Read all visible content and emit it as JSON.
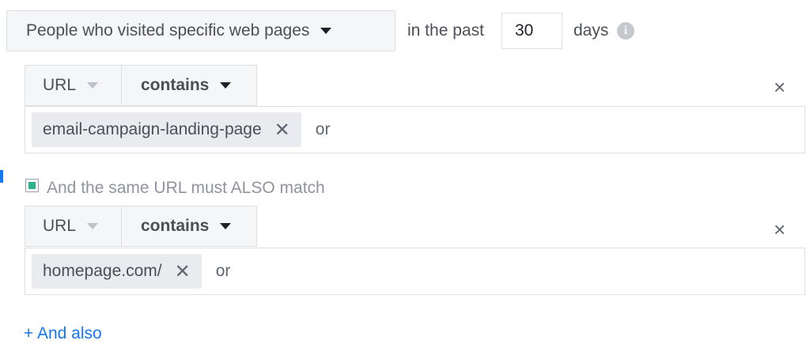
{
  "audience": {
    "selector_label": "People who visited specific web pages",
    "in_the_past_label": "in the past",
    "days_value": "30",
    "days_label": "days"
  },
  "rules": [
    {
      "field_label": "URL",
      "operator_label": "contains",
      "tokens": [
        "email-campaign-landing-page"
      ],
      "or_label": "or"
    },
    {
      "field_label": "URL",
      "operator_label": "contains",
      "tokens": [
        "homepage.com/"
      ],
      "or_label": "or"
    }
  ],
  "same_url_match": {
    "label": "And the same URL must ALSO match",
    "checked": true
  },
  "and_also_link": "+ And also",
  "icons": {
    "remove": "×",
    "token_remove": "✕",
    "info": "i"
  },
  "colors": {
    "accent": "#1877f2",
    "checkbox_fill": "#2db08e"
  }
}
